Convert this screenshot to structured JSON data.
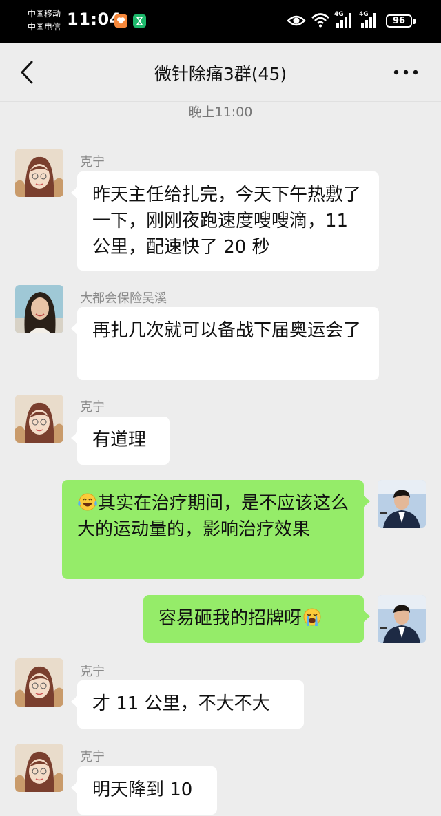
{
  "status_bar": {
    "carrier_1": "中国移动",
    "carrier_2": "中国电信",
    "time": "11:04",
    "network_1": "4G",
    "network_2": "4G",
    "battery": "96",
    "icons": [
      "health-app-icon",
      "timer-app-icon",
      "eye-icon",
      "wifi-icon",
      "signal-icon",
      "signal-icon",
      "battery-icon"
    ]
  },
  "header": {
    "title": "微针除痛3群(45)",
    "back_icon": "chevron-left-icon",
    "more_icon": "more-dots-icon"
  },
  "chat": {
    "timestamp": "晚上11:00",
    "messages": [
      {
        "side": "in",
        "sender": "克宁",
        "text": "昨天主任给扎完，今天下午热敷了一下，刚刚夜跑速度嗖嗖滴，11 公里，配速快了 20 秒"
      },
      {
        "side": "in",
        "sender": "大都会保险吴溪",
        "text": "再扎几次就可以备战下届奥运会了"
      },
      {
        "side": "in",
        "sender": "克宁",
        "text": "有道理"
      },
      {
        "side": "out",
        "emoji_prefix": "tears-of-joy-emoji",
        "text": "其实在治疗期间，是不应该这么大的运动量的，影响治疗效果"
      },
      {
        "side": "out",
        "emoji_suffix": "loudly-crying-face-emoji",
        "text": "容易砸我的招牌呀"
      },
      {
        "side": "in",
        "sender": "克宁",
        "text": "才 11 公里，不大不大"
      },
      {
        "side": "in",
        "sender": "克宁",
        "text": "明天降到 10"
      }
    ]
  },
  "colors": {
    "status_bar_bg": "#000000",
    "chat_bg": "#ededed",
    "incoming_bubble": "#ffffff",
    "outgoing_bubble": "#95ec69",
    "sender_name": "#8a8a8a"
  }
}
